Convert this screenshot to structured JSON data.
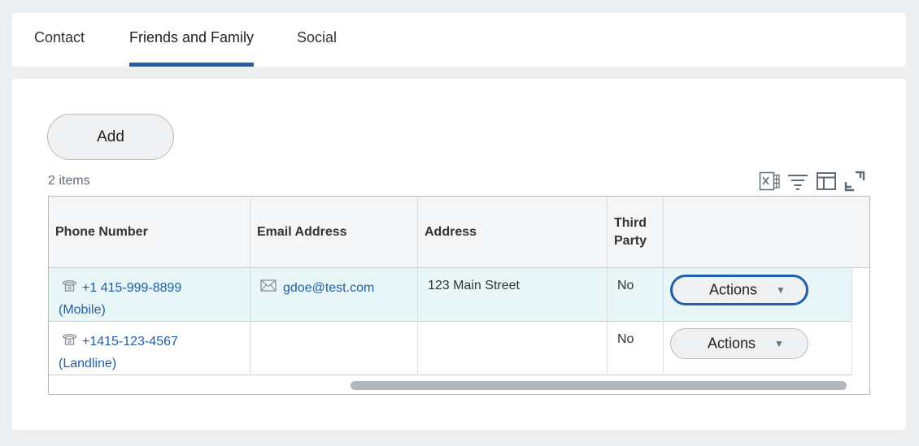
{
  "tabs": [
    {
      "label": "Contact",
      "active": false
    },
    {
      "label": "Friends and Family",
      "active": true
    },
    {
      "label": "Social",
      "active": false
    }
  ],
  "add_button": {
    "label": "Add"
  },
  "items_count": "2 items",
  "toolbar_icons": [
    "export-excel-icon",
    "filter-icon",
    "columns-icon",
    "fullscreen-icon"
  ],
  "table": {
    "columns": [
      "Phone Number",
      "Email Address",
      "Address",
      "Third Party",
      ""
    ],
    "rows": [
      {
        "phone_number": "+1 415-999-8899",
        "phone_type": "(Mobile)",
        "email": "gdoe@test.com",
        "address": "123 Main Street",
        "third_party": "No",
        "actions_label": "Actions"
      },
      {
        "phone_number": "+1415-123-4567",
        "phone_type": "(Landline)",
        "email": "",
        "address": "",
        "third_party": "No",
        "actions_label": "Actions"
      }
    ]
  },
  "colors": {
    "accent": "#1f5faa",
    "selected_row": "#e8f6f8",
    "page_bg": "#eceef0"
  }
}
